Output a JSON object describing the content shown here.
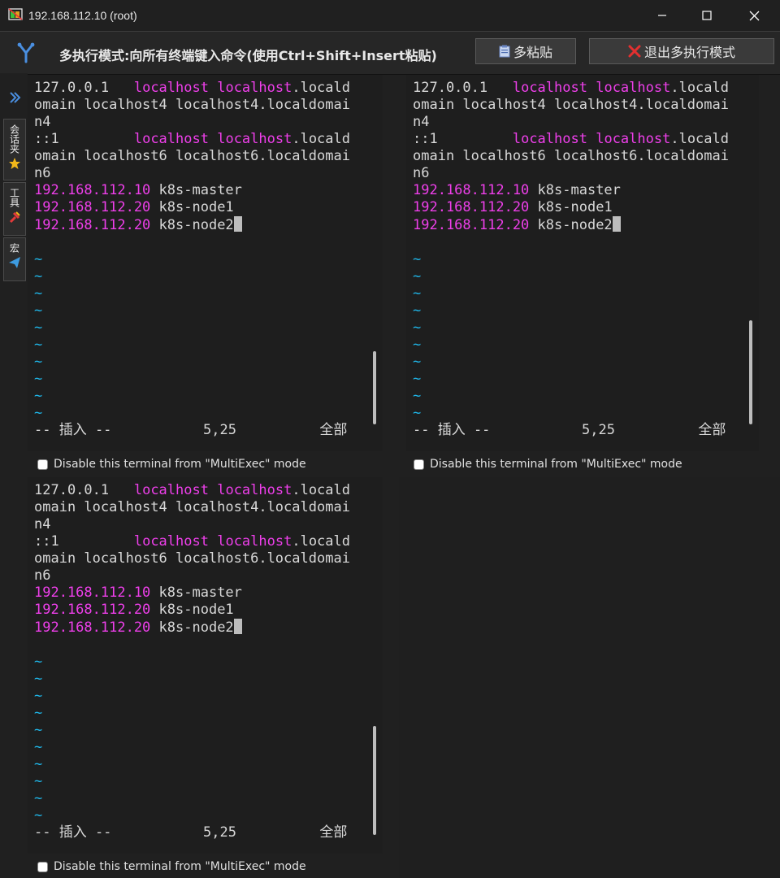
{
  "window": {
    "title": "192.168.112.10 (root)",
    "minimize_icon": "minimize-icon",
    "maximize_icon": "maximize-icon",
    "close_icon": "close-icon"
  },
  "multiexec": {
    "message": "多执行模式:向所有终端键入命令(使用Ctrl+Shift+Insert粘贴)",
    "paste_button": "多粘贴",
    "exit_button": "退出多执行模式",
    "exit_icon_color": "#e23030"
  },
  "sidebar": {
    "tabs": [
      {
        "label": "会话夹",
        "icon": "star-icon"
      },
      {
        "label": "工具",
        "icon": "tools-icon"
      },
      {
        "label": "宏",
        "icon": "send-icon"
      }
    ]
  },
  "terminal": {
    "hosts": [
      [
        "127.0.0.1",
        "   ",
        "localhost",
        " ",
        "localhost",
        ".locald"
      ],
      [
        "omain localhost4 localhost4.localdomai"
      ],
      [
        "n4"
      ],
      [
        ":1",
        "",
        "",
        "",
        "",
        ""
      ],
      [
        "omain localhost6 localhost6.localdomai"
      ],
      [
        "n6"
      ]
    ],
    "line1": "127.0.0.1",
    "line1_kw1": "localhost",
    "line1_kw2": "localhost",
    "line1_rest": ".locald",
    "line2": "omain localhost4 localhost4.localdomai",
    "line3": "n4",
    "line4": "::1",
    "line4_kw1": "localhost",
    "line4_kw2": "localhost",
    "line4_rest": ".locald",
    "line5": "omain localhost6 localhost6.localdomai",
    "line6": "n6",
    "ip1": "192.168.112.10",
    "name1": "k8s-master",
    "ip2": "192.168.112.20",
    "name2": "k8s-node1",
    "ip3": "192.168.112.20",
    "name3": "k8s-node2",
    "tilde": "~",
    "mode": "-- 插入 --",
    "position": "5,25",
    "scope": "全部",
    "disable_label": "Disable this terminal from \"MultiExec\" mode"
  },
  "colors": {
    "magenta": "#ee3fea",
    "tilde": "#1fb6e8"
  }
}
